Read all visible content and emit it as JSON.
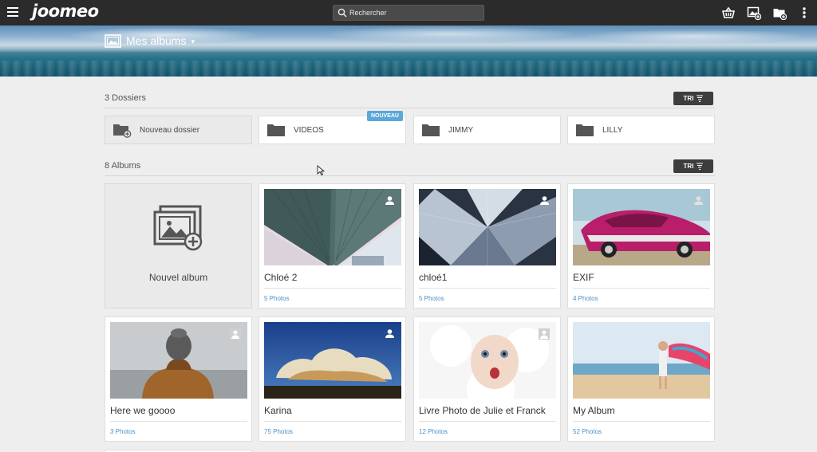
{
  "header": {
    "logo": "joomeo",
    "search_placeholder": "Rechercher"
  },
  "banner": {
    "title": "Mes albums"
  },
  "folders": {
    "count_label": "3 Dossiers",
    "sort_label": "TRI",
    "new_folder_label": "Nouveau dossier",
    "items": [
      {
        "label": "VIDEOS",
        "badge": "NOUVEAU"
      },
      {
        "label": "JIMMY",
        "badge": ""
      },
      {
        "label": "LILLY",
        "badge": ""
      }
    ]
  },
  "albums": {
    "count_label": "8 Albums",
    "sort_label": "TRI",
    "new_album_label": "Nouvel album",
    "items": [
      {
        "title": "Chloé 2",
        "count": "5 Photos"
      },
      {
        "title": "chloé1",
        "count": "5 Photos"
      },
      {
        "title": "EXIF",
        "count": "4 Photos"
      },
      {
        "title": "Here we goooo",
        "count": "3 Photos"
      },
      {
        "title": "Karina",
        "count": "75 Photos"
      },
      {
        "title": "Livre Photo de Julie et Franck",
        "count": "12 Photos"
      },
      {
        "title": "My Album",
        "count": "52 Photos"
      }
    ]
  },
  "colors": {
    "topbar": "#2b2b2b",
    "accent": "#4a90c8",
    "badge": "#5aa8d8"
  }
}
